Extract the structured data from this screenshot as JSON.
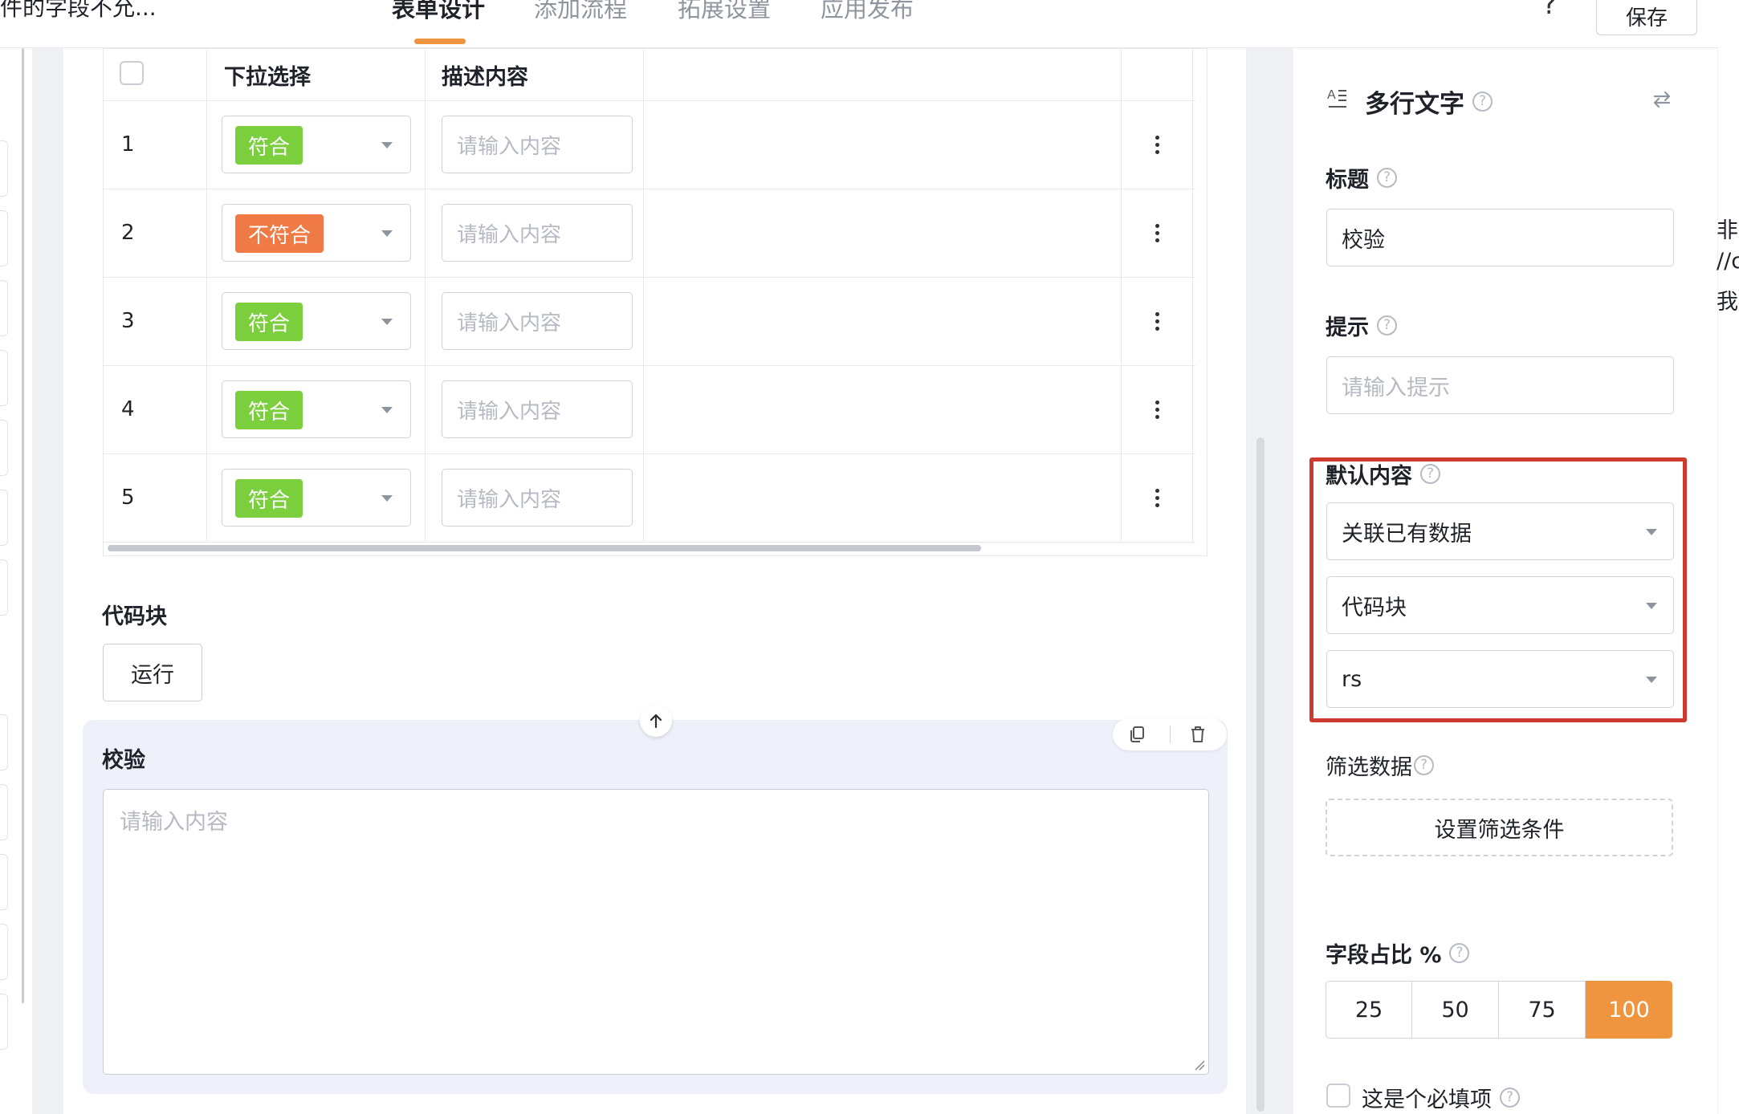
{
  "header": {
    "doc_title": "件的字段不允...",
    "tabs": [
      {
        "label": "表单设计",
        "active": true
      },
      {
        "label": "添加流程",
        "active": false
      },
      {
        "label": "拓展设置",
        "active": false
      },
      {
        "label": "应用发布",
        "active": false
      }
    ],
    "help_glyph": "?",
    "save_label": "保存"
  },
  "table": {
    "columns": [
      "下拉选择",
      "描述内容"
    ],
    "rows": [
      {
        "index": "1",
        "status": "符合",
        "status_type": "ok",
        "desc_placeholder": "请输入内容"
      },
      {
        "index": "2",
        "status": "不符合",
        "status_type": "bad",
        "desc_placeholder": "请输入内容"
      },
      {
        "index": "3",
        "status": "符合",
        "status_type": "ok",
        "desc_placeholder": "请输入内容"
      },
      {
        "index": "4",
        "status": "符合",
        "status_type": "ok",
        "desc_placeholder": "请输入内容"
      },
      {
        "index": "5",
        "status": "符合",
        "status_type": "ok",
        "desc_placeholder": "请输入内容"
      }
    ]
  },
  "code_block": {
    "label": "代码块",
    "run_label": "运行"
  },
  "verify_block": {
    "label": "校验",
    "placeholder": "请输入内容"
  },
  "panel": {
    "component_title": "多行文字",
    "title_label": "标题",
    "title_value": "校验",
    "hint_label": "提示",
    "hint_placeholder": "请输入提示",
    "default_label": "默认内容",
    "default_source": "关联已有数据",
    "default_type": "代码块",
    "default_var": "rs",
    "filter_label": "筛选数据",
    "filter_button": "设置筛选条件",
    "width_label": "字段占比 %",
    "width_options": [
      "25",
      "50",
      "75",
      "100"
    ],
    "width_selected": "100",
    "required_label": "这是个必填项",
    "question_glyph": "?"
  },
  "edge_fragments": [
    "非",
    "//c",
    "我"
  ],
  "colors": {
    "accent": "#f0953f",
    "ok_tag": "#7ccf3c",
    "bad_tag": "#ef7a45",
    "highlight": "#cc3b2d"
  }
}
